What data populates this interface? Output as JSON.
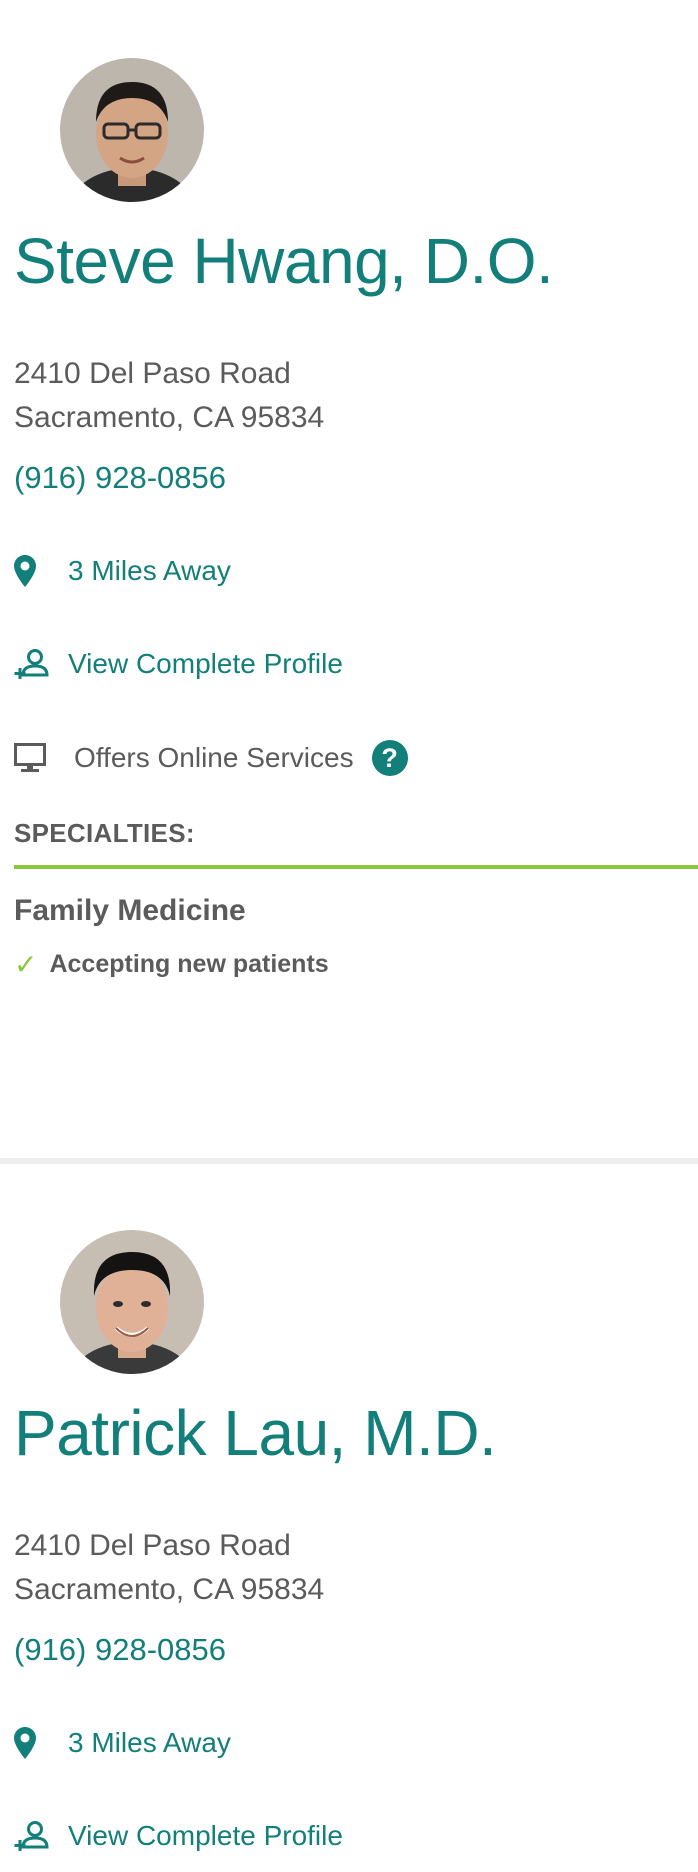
{
  "providers": [
    {
      "name": "Steve Hwang, D.O.",
      "address_line1": "2410 Del Paso Road",
      "address_line2": "Sacramento, CA 95834",
      "phone": "(916) 928-0856",
      "distance": "3 Miles Away",
      "profile_link": "View Complete Profile",
      "online_services": "Offers Online Services",
      "help_icon_glyph": "?",
      "specialties_heading": "SPECIALTIES:",
      "specialty": "Family Medicine",
      "accepting": "Accepting new patients"
    },
    {
      "name": "Patrick Lau, M.D.",
      "address_line1": "2410 Del Paso Road",
      "address_line2": "Sacramento, CA 95834",
      "phone": "(916) 928-0856",
      "distance": "3 Miles Away",
      "profile_link": "View Complete Profile"
    }
  ],
  "icons": {
    "check": "✓",
    "location": "map-pin-icon",
    "profile": "add-user-icon",
    "monitor": "monitor-icon",
    "help": "question-circle-icon"
  },
  "colors": {
    "teal": "#127f7a",
    "green": "#8cc63f",
    "text": "#5b5b5b",
    "divider": "#eeeeee"
  }
}
